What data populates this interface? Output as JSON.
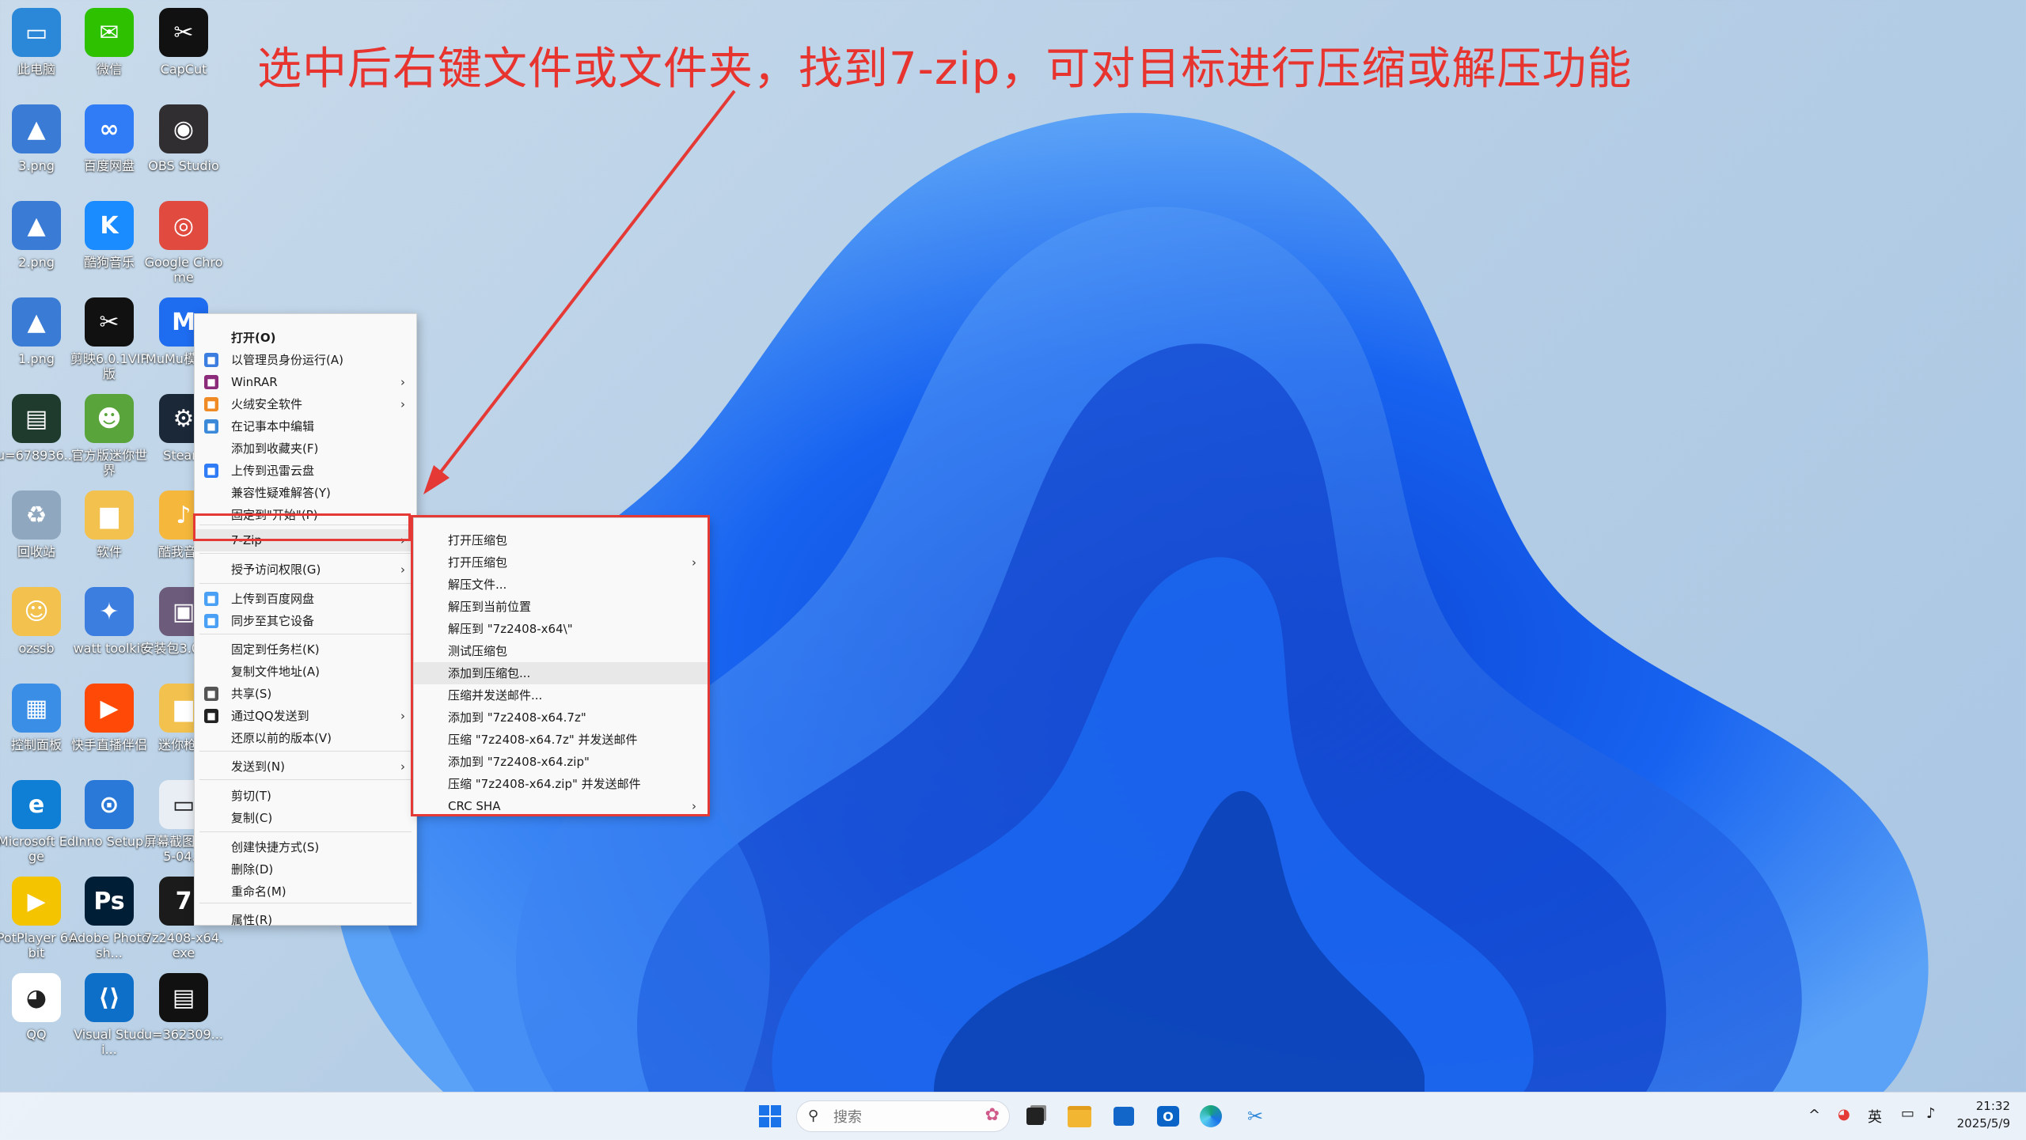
{
  "annotation": {
    "text": "选中后右键文件或文件夹，找到7-zip，可对目标进行压缩或解压功能",
    "color": "#e8342f"
  },
  "desktop_icons": [
    {
      "label": "此电脑",
      "icon": "computer-icon",
      "color": "#2b88d8",
      "glyph": "▭"
    },
    {
      "label": "微信",
      "icon": "wechat-icon",
      "color": "#2dc100",
      "glyph": "✉"
    },
    {
      "label": "CapCut",
      "icon": "capcut-icon",
      "color": "#111111",
      "glyph": "✂"
    },
    {
      "label": "3.png",
      "icon": "image-file-icon",
      "color": "#3a7bd5",
      "glyph": "▲"
    },
    {
      "label": "百度网盘",
      "icon": "baidu-netdisk-icon",
      "color": "#2f7cf6",
      "glyph": "∞"
    },
    {
      "label": "OBS Studio",
      "icon": "obs-icon",
      "color": "#302e31",
      "glyph": "◉"
    },
    {
      "label": "2.png",
      "icon": "image-file-icon",
      "color": "#3a7bd5",
      "glyph": "▲"
    },
    {
      "label": "酷狗音乐",
      "icon": "kugou-icon",
      "color": "#1a8cff",
      "glyph": "K"
    },
    {
      "label": "Google Chrome",
      "icon": "chrome-icon",
      "color": "#e04a3f",
      "glyph": "◎"
    },
    {
      "label": "1.png",
      "icon": "image-file-icon",
      "color": "#3a7bd5",
      "glyph": "▲"
    },
    {
      "label": "剪映6.0.1VIP版",
      "icon": "jianying-icon",
      "color": "#111111",
      "glyph": "✂"
    },
    {
      "label": "MuMu模拟器",
      "icon": "mumu-icon",
      "color": "#1e6cf0",
      "glyph": "M"
    },
    {
      "label": "u=678936...",
      "icon": "image-thumb-icon",
      "color": "#1f3b2d",
      "glyph": "▤"
    },
    {
      "label": "官方版迷你世界",
      "icon": "mini-world-icon",
      "color": "#5aa43c",
      "glyph": "☻"
    },
    {
      "label": "Steam",
      "icon": "steam-icon",
      "color": "#1b2838",
      "glyph": "⚙"
    },
    {
      "label": "回收站",
      "icon": "recycle-bin-icon",
      "color": "#8fa7bf",
      "glyph": "♻"
    },
    {
      "label": "软件",
      "icon": "folder-icon",
      "color": "#f2c14e",
      "glyph": "▆"
    },
    {
      "label": "酷我音乐",
      "icon": "kuwo-icon",
      "color": "#f5b83d",
      "glyph": "♪"
    },
    {
      "label": "ozssb",
      "icon": "user-folder-icon",
      "color": "#f2c14e",
      "glyph": "☺"
    },
    {
      "label": "watt toolkit",
      "icon": "watt-toolkit-icon",
      "color": "#3c7de0",
      "glyph": "✦"
    },
    {
      "label": "安装包3.0.exe",
      "icon": "installer-icon",
      "color": "#6c5b7b",
      "glyph": "▣"
    },
    {
      "label": "控制面板",
      "icon": "control-panel-icon",
      "color": "#3a8ee6",
      "glyph": "▦"
    },
    {
      "label": "快手直播伴侣",
      "icon": "kuaishou-icon",
      "color": "#ff4906",
      "glyph": "▶"
    },
    {
      "label": "迷你枪战",
      "icon": "folder-icon",
      "color": "#f2c14e",
      "glyph": "▆"
    },
    {
      "label": "Microsoft Edge",
      "icon": "edge-icon",
      "color": "#0f7fd6",
      "glyph": "e"
    },
    {
      "label": "Inno Setup",
      "icon": "inno-setup-icon",
      "color": "#2a79d9",
      "glyph": "⊙"
    },
    {
      "label": "屏幕截图 2025-04...",
      "icon": "screenshot-icon",
      "color": "#e9eef4",
      "glyph": "▭"
    },
    {
      "label": "PotPlayer 64 bit",
      "icon": "potplayer-icon",
      "color": "#f5c400",
      "glyph": "▶"
    },
    {
      "label": "Adobe Photosh...",
      "icon": "photoshop-icon",
      "color": "#001e36",
      "glyph": "Ps"
    },
    {
      "label": "7z2408-x64.exe",
      "icon": "7zip-icon",
      "color": "#1b1b1b",
      "glyph": "7"
    },
    {
      "label": "QQ",
      "icon": "qq-icon",
      "color": "#ffffff",
      "glyph": "◕"
    },
    {
      "label": "Visual Studi...",
      "icon": "vscode-icon",
      "color": "#0e6fc9",
      "glyph": "⟨⟩"
    },
    {
      "label": "u=362309...",
      "icon": "image-thumb-icon",
      "color": "#111111",
      "glyph": "▤"
    }
  ],
  "context_menu": {
    "items": [
      {
        "label": "打开(O)",
        "icon": "",
        "bold": true,
        "submenu": false
      },
      {
        "label": "以管理员身份运行(A)",
        "icon": "shield-icon",
        "icon_color": "#3c7de0",
        "submenu": false
      },
      {
        "label": "WinRAR",
        "icon": "winrar-icon",
        "icon_color": "#8b2b7a",
        "submenu": true
      },
      {
        "label": "火绒安全软件",
        "icon": "huorong-icon",
        "icon_color": "#f08a24",
        "submenu": true
      },
      {
        "label": "在记事本中编辑",
        "icon": "notepad-icon",
        "icon_color": "#3b89d9",
        "submenu": false
      },
      {
        "label": "添加到收藏夹(F)",
        "icon": "",
        "submenu": false
      },
      {
        "label": "上传到迅雷云盘",
        "icon": "xunlei-icon",
        "icon_color": "#2f7cf6",
        "submenu": false
      },
      {
        "label": "兼容性疑难解答(Y)",
        "icon": "",
        "submenu": false
      },
      {
        "label": "固定到\"开始\"(P)",
        "icon": "",
        "submenu": false
      },
      {
        "label": "7-Zip",
        "icon": "",
        "submenu": true,
        "highlighted": true
      },
      {
        "label": "授予访问权限(G)",
        "icon": "",
        "submenu": true
      },
      {
        "label": "上传到百度网盘",
        "icon": "baidu-netdisk-icon",
        "icon_color": "#4aa0f5",
        "submenu": false
      },
      {
        "label": "同步至其它设备",
        "icon": "baidu-sync-icon",
        "icon_color": "#4aa0f5",
        "submenu": false
      },
      {
        "label": "固定到任务栏(K)",
        "icon": "",
        "submenu": false
      },
      {
        "label": "复制文件地址(A)",
        "icon": "",
        "submenu": false
      },
      {
        "label": "共享(S)",
        "icon": "share-icon",
        "icon_color": "#555555",
        "submenu": false
      },
      {
        "label": "通过QQ发送到",
        "icon": "qq-icon",
        "icon_color": "#222222",
        "submenu": true
      },
      {
        "label": "还原以前的版本(V)",
        "icon": "",
        "submenu": false
      },
      {
        "label": "发送到(N)",
        "icon": "",
        "submenu": true
      },
      {
        "label": "剪切(T)",
        "icon": "",
        "submenu": false
      },
      {
        "label": "复制(C)",
        "icon": "",
        "submenu": false
      },
      {
        "label": "创建快捷方式(S)",
        "icon": "",
        "submenu": false
      },
      {
        "label": "删除(D)",
        "icon": "",
        "submenu": false
      },
      {
        "label": "重命名(M)",
        "icon": "",
        "submenu": false
      },
      {
        "label": "属性(R)",
        "icon": "",
        "submenu": false
      }
    ]
  },
  "sevenzip_submenu": {
    "items": [
      {
        "label": "打开压缩包",
        "submenu": false
      },
      {
        "label": "打开压缩包",
        "submenu": true
      },
      {
        "label": "解压文件...",
        "submenu": false
      },
      {
        "label": "解压到当前位置",
        "submenu": false
      },
      {
        "label": "解压到 \"7z2408-x64\\\"",
        "submenu": false
      },
      {
        "label": "测试压缩包",
        "submenu": false
      },
      {
        "label": "添加到压缩包...",
        "submenu": false,
        "highlighted": true
      },
      {
        "label": "压缩并发送邮件...",
        "submenu": false
      },
      {
        "label": "添加到 \"7z2408-x64.7z\"",
        "submenu": false
      },
      {
        "label": "压缩 \"7z2408-x64.7z\" 并发送邮件",
        "submenu": false
      },
      {
        "label": "添加到 \"7z2408-x64.zip\"",
        "submenu": false
      },
      {
        "label": "压缩 \"7z2408-x64.zip\" 并发送邮件",
        "submenu": false
      },
      {
        "label": "CRC SHA",
        "submenu": true
      }
    ]
  },
  "taskbar": {
    "search_placeholder": "搜索",
    "ime": "英",
    "time": "21:32",
    "date": "2025/5/9",
    "apps": [
      {
        "name": "start-button",
        "icon": "windows-icon",
        "color": "#1a73e8"
      },
      {
        "name": "task-view",
        "icon": "task-view-icon",
        "color": "#222222"
      },
      {
        "name": "file-explorer",
        "icon": "folder-icon",
        "color": "#f2b632"
      },
      {
        "name": "microsoft-store",
        "icon": "store-icon",
        "color": "#1266c9"
      },
      {
        "name": "outlook",
        "icon": "outlook-icon",
        "color": "#0a64c8"
      },
      {
        "name": "edge",
        "icon": "edge-icon",
        "color": "#18a37a"
      },
      {
        "name": "snipping-tool",
        "icon": "snip-icon",
        "color": "#2f88d8"
      }
    ]
  }
}
